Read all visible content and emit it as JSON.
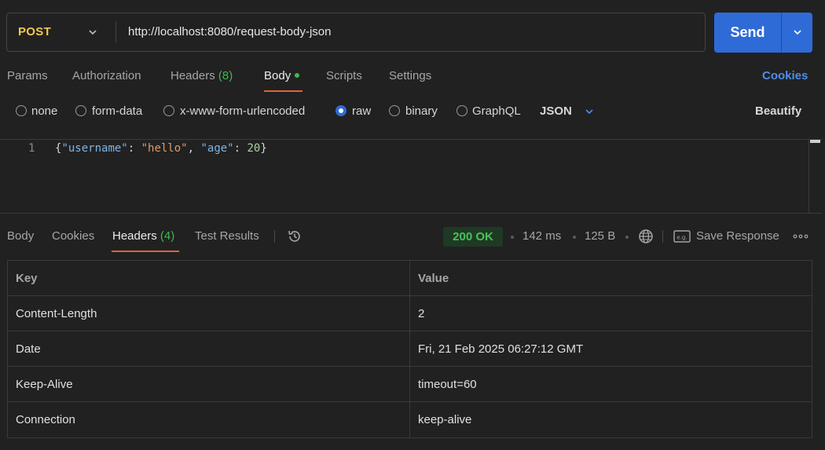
{
  "request": {
    "method": "POST",
    "url": "http://localhost:8080/request-body-json",
    "send_label": "Send"
  },
  "request_tabs": [
    {
      "label": "Params"
    },
    {
      "label": "Authorization"
    },
    {
      "label": "Headers",
      "count": "(8)"
    },
    {
      "label": "Body"
    },
    {
      "label": "Scripts"
    },
    {
      "label": "Settings"
    }
  ],
  "cookies_link": "Cookies",
  "body_types": [
    "none",
    "form-data",
    "x-www-form-urlencoded",
    "raw",
    "binary",
    "GraphQL"
  ],
  "selected_body_type": "raw",
  "body_format": "JSON",
  "beautify_label": "Beautify",
  "editor": {
    "line_number": "1",
    "tokens": {
      "open": "{",
      "key1": "\"username\"",
      "sep1": ": ",
      "val1": "\"hello\"",
      "comma": ", ",
      "key2": "\"age\"",
      "sep2": ": ",
      "val2": "20",
      "close": "}"
    }
  },
  "response_tabs": [
    {
      "label": "Body"
    },
    {
      "label": "Cookies"
    },
    {
      "label": "Headers",
      "count": "(4)"
    },
    {
      "label": "Test Results"
    }
  ],
  "response_meta": {
    "status": "200 OK",
    "time": "142 ms",
    "size": "125 B",
    "save_response": "Save Response"
  },
  "headers_table": {
    "columns": [
      "Key",
      "Value"
    ],
    "rows": [
      [
        "Content-Length",
        "2"
      ],
      [
        "Date",
        "Fri, 21 Feb 2025 06:27:12 GMT"
      ],
      [
        "Keep-Alive",
        "timeout=60"
      ],
      [
        "Connection",
        "keep-alive"
      ]
    ]
  },
  "colors": {
    "background": "#212121",
    "accent_blue": "#2f6bd6",
    "method_yellow": "#f2c94c",
    "status_green": "#49c25a",
    "tab_underline": "#e0623a"
  },
  "icons": {
    "method_dropdown": "chevron-down-icon",
    "send_dropdown": "chevron-down-icon",
    "history": "history-icon",
    "globe": "globe-icon",
    "save_response": "save-example-icon",
    "more": "more-horizontal-icon"
  }
}
